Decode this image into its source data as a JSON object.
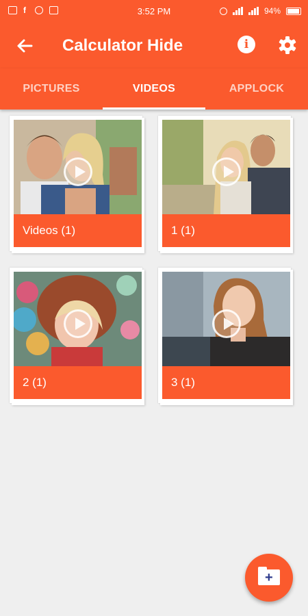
{
  "status_bar": {
    "time": "3:52 PM",
    "battery": "94%"
  },
  "app_bar": {
    "title": "Calculator Hide"
  },
  "tabs": [
    {
      "label": "PICTURES",
      "active": false
    },
    {
      "label": "VIDEOS",
      "active": true
    },
    {
      "label": "APPLOCK",
      "active": false
    }
  ],
  "folders": [
    {
      "label": "Videos (1)"
    },
    {
      "label": "1 (1)"
    },
    {
      "label": "2 (1)"
    },
    {
      "label": "3 (1)"
    }
  ],
  "colors": {
    "accent": "#fb5a2d",
    "background": "#efefef",
    "fab_plus": "#2d3a8c"
  }
}
